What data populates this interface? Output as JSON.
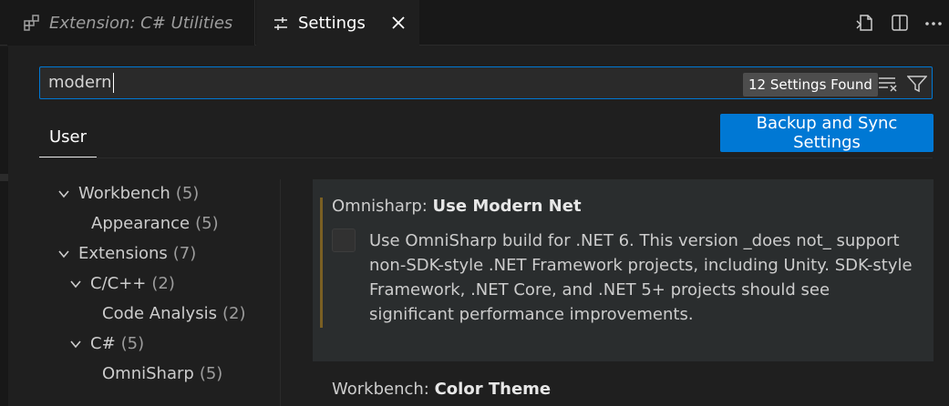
{
  "tabs": [
    {
      "label": "Extension: C# Utilities",
      "icon": "extensions-icon",
      "active": false
    },
    {
      "label": "Settings",
      "icon": "settings-sliders-icon",
      "active": true
    }
  ],
  "toolbar": {
    "icons": [
      "open-settings-json-icon",
      "split-editor-icon",
      "more-actions-icon"
    ]
  },
  "search": {
    "value": "modern",
    "results_badge": "12 Settings Found"
  },
  "scope": {
    "active_tab": "User"
  },
  "sync_button": {
    "label": "Backup and Sync Settings"
  },
  "tree": [
    {
      "label": "Workbench",
      "count": "(5)",
      "expanded": true
    },
    {
      "label": "Appearance",
      "count": "(5)"
    },
    {
      "label": "Extensions",
      "count": "(7)",
      "expanded": true
    },
    {
      "label": "C/C++",
      "count": "(2)",
      "expanded": true
    },
    {
      "label": "Code Analysis",
      "count": "(2)"
    },
    {
      "label": "C#",
      "count": "(5)",
      "expanded": true
    },
    {
      "label": "OmniSharp",
      "count": "(5)"
    }
  ],
  "settings": [
    {
      "category": "Omnisharp: ",
      "name": "Use Modern Net",
      "checked": false,
      "description": "Use OmniSharp build for .NET 6. This version _does not_ support non-SDK-style .NET Framework projects, including Unity. SDK-style Framework, .NET Core, and .NET 5+ projects should see significant performance improvements."
    },
    {
      "category": "Workbench: ",
      "name": "Color Theme"
    }
  ],
  "colors": {
    "accent": "#0078d4",
    "modified_indicator": "#7a5f23",
    "background": "#1f1f1f"
  }
}
